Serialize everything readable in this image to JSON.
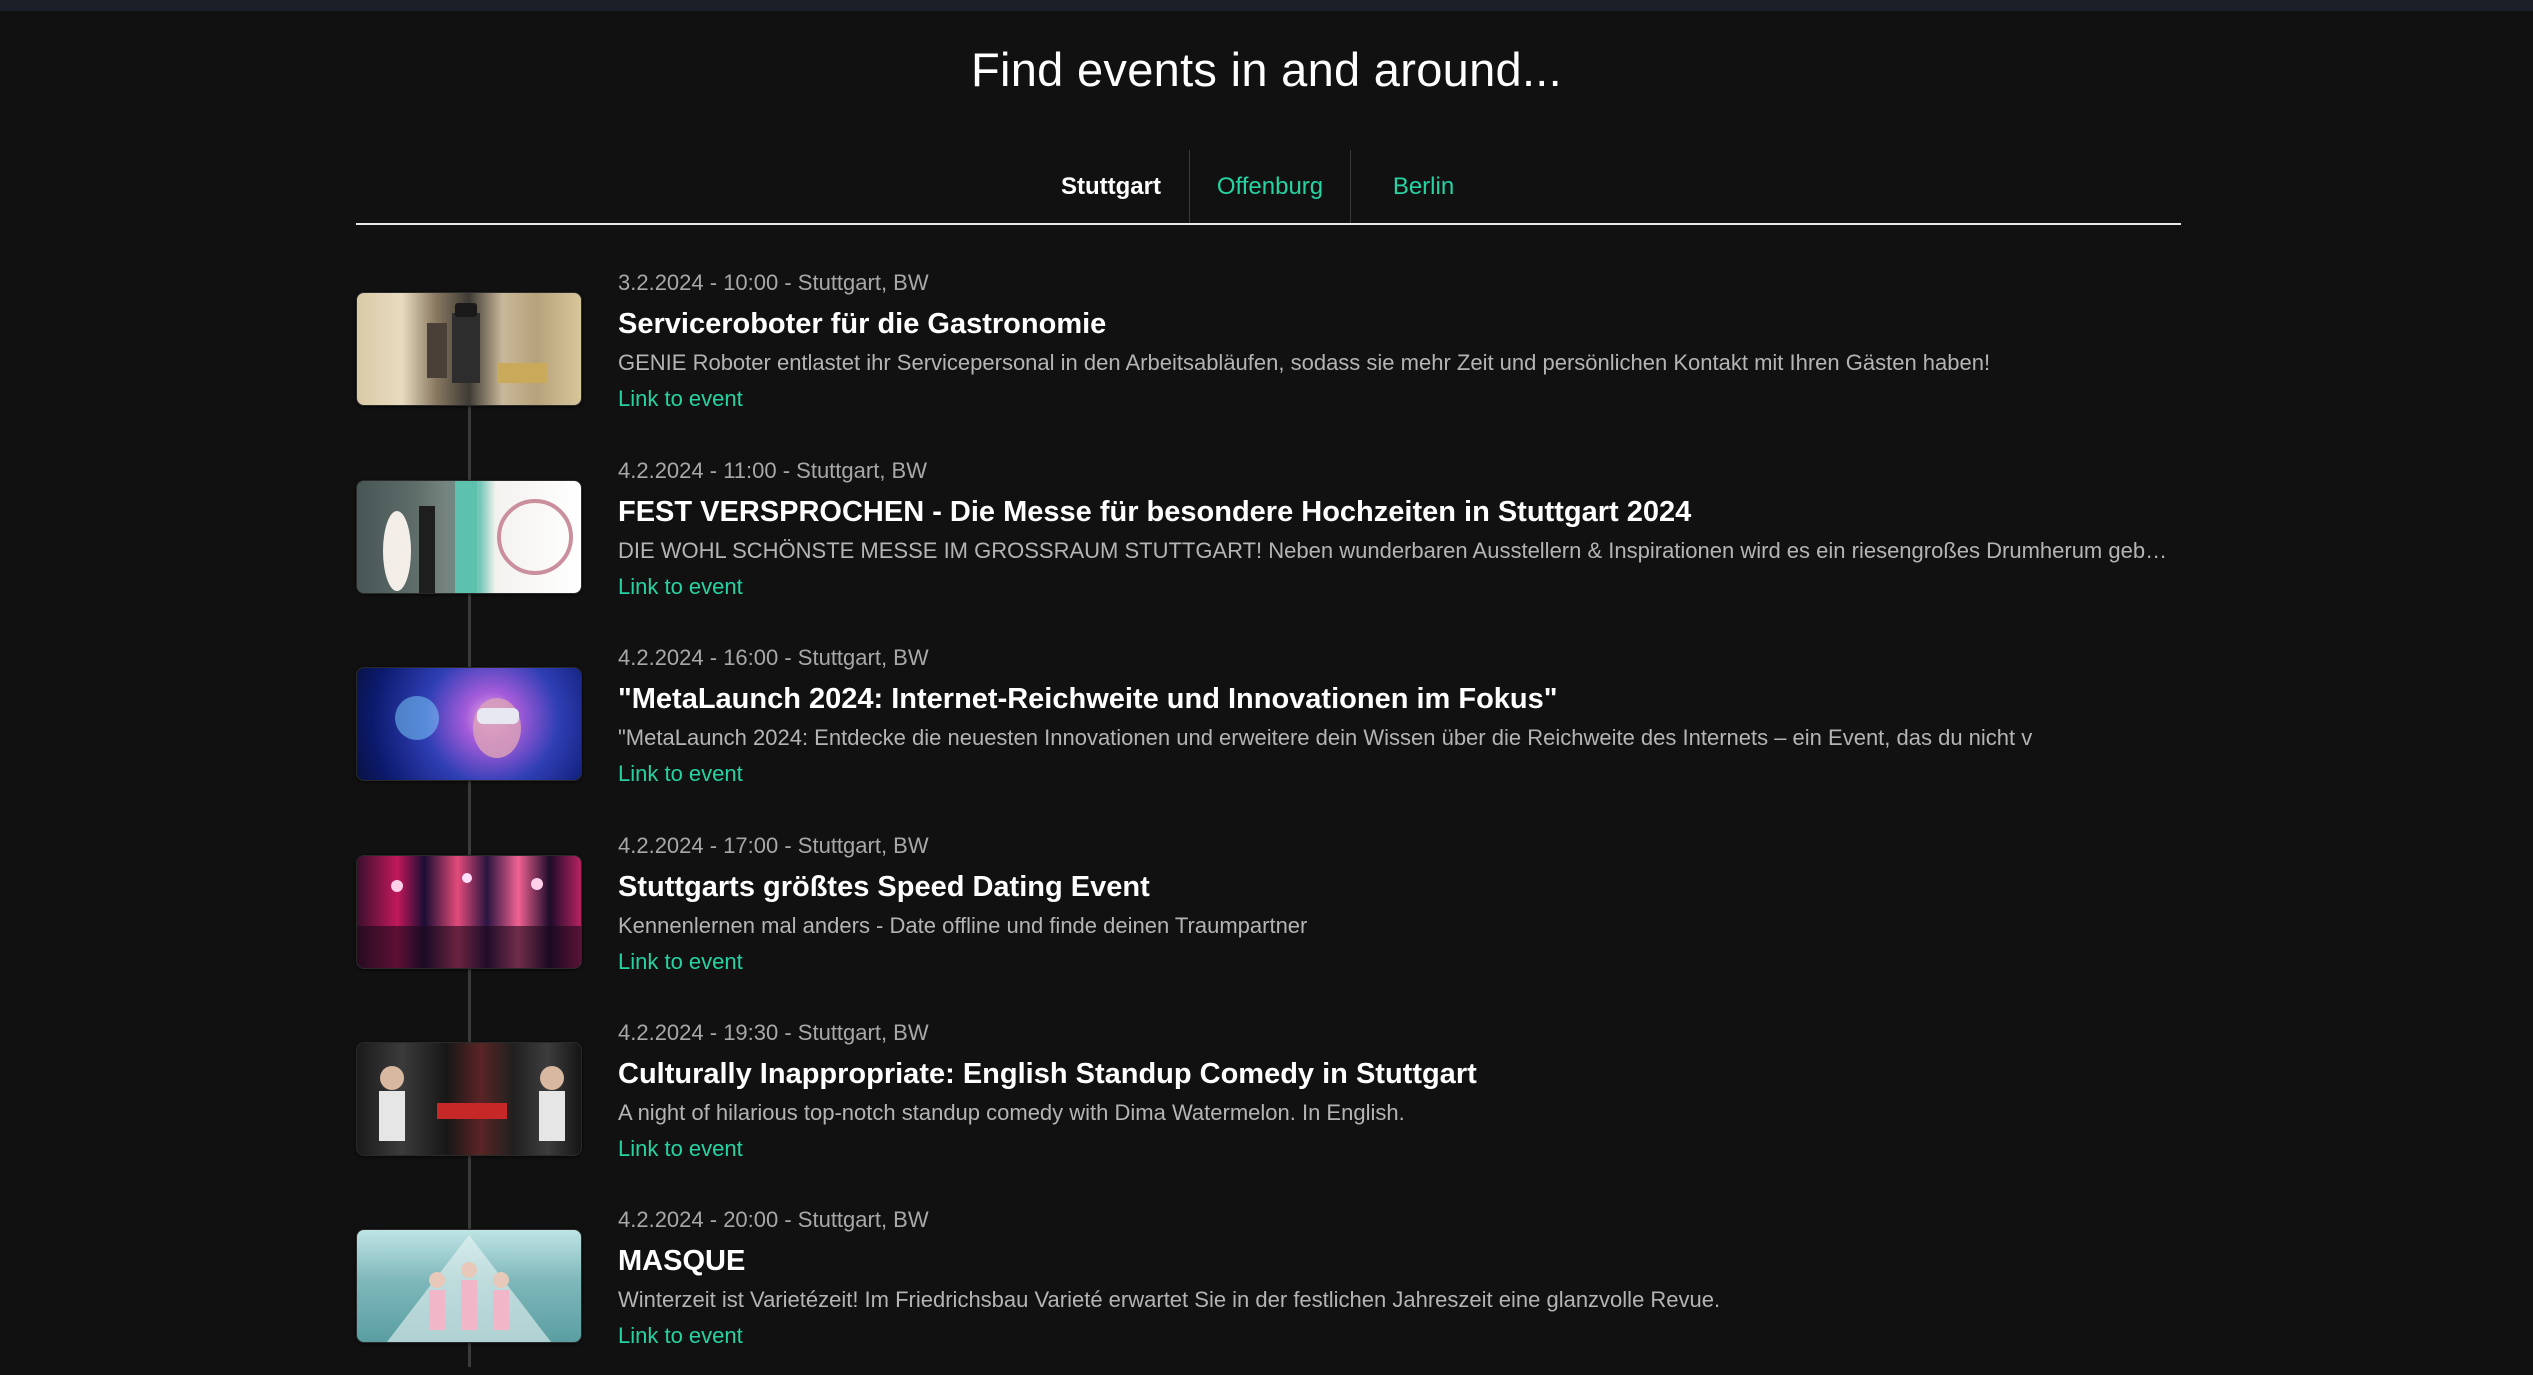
{
  "header": {
    "title": "Find events in and around..."
  },
  "tabs": [
    {
      "label": "Stuttgart",
      "active": true
    },
    {
      "label": "Offenburg",
      "active": false
    },
    {
      "label": "Berlin",
      "active": false
    }
  ],
  "colors": {
    "background": "#111111",
    "accent": "#26d3a3",
    "text": "#ffffff",
    "muted": "#a8a8a8"
  },
  "events": [
    {
      "meta": "3.2.2024 - 10:00 - Stuttgart, BW",
      "title": "Serviceroboter für die Gastronomie",
      "description": "GENIE Roboter entlastet ihr Servicepersonal in den Arbeitsabläufen, sodass sie mehr Zeit und persönlichen Kontakt mit Ihren Gästen haben!",
      "link_label": "Link to event"
    },
    {
      "meta": "4.2.2024 - 11:00 - Stuttgart, BW",
      "title": "FEST VERSPROCHEN - Die Messe für besondere Hochzeiten in Stuttgart 2024",
      "description": "DIE WOHL SCHÖNSTE MESSE IM GROSSRAUM STUTTGART! Neben wunderbaren Ausstellern & Inspirationen wird es ein riesengroßes Drumherum geben...",
      "link_label": "Link to event"
    },
    {
      "meta": "4.2.2024 - 16:00 - Stuttgart, BW",
      "title": "\"MetaLaunch 2024: Internet-Reichweite und Innovationen im Fokus\"",
      "description": "\"MetaLaunch 2024: Entdecke die neuesten Innovationen und erweitere dein Wissen über die Reichweite des Internets – ein Event, das du nicht v",
      "link_label": "Link to event"
    },
    {
      "meta": "4.2.2024 - 17:00 - Stuttgart, BW",
      "title": "Stuttgarts größtes Speed Dating Event",
      "description": "Kennenlernen mal anders - Date offline und finde deinen Traumpartner",
      "link_label": "Link to event"
    },
    {
      "meta": "4.2.2024 - 19:30 - Stuttgart, BW",
      "title": "Culturally Inappropriate: English Standup Comedy in Stuttgart",
      "description": "A night of hilarious top-notch standup comedy with Dima Watermelon. In English.",
      "link_label": "Link to event"
    },
    {
      "meta": "4.2.2024 - 20:00 - Stuttgart, BW",
      "title": "MASQUE",
      "description": "Winterzeit ist Varietézeit! Im Friedrichsbau Varieté erwartet Sie in der festlichen Jahreszeit eine glanzvolle Revue.",
      "link_label": "Link to event"
    }
  ]
}
